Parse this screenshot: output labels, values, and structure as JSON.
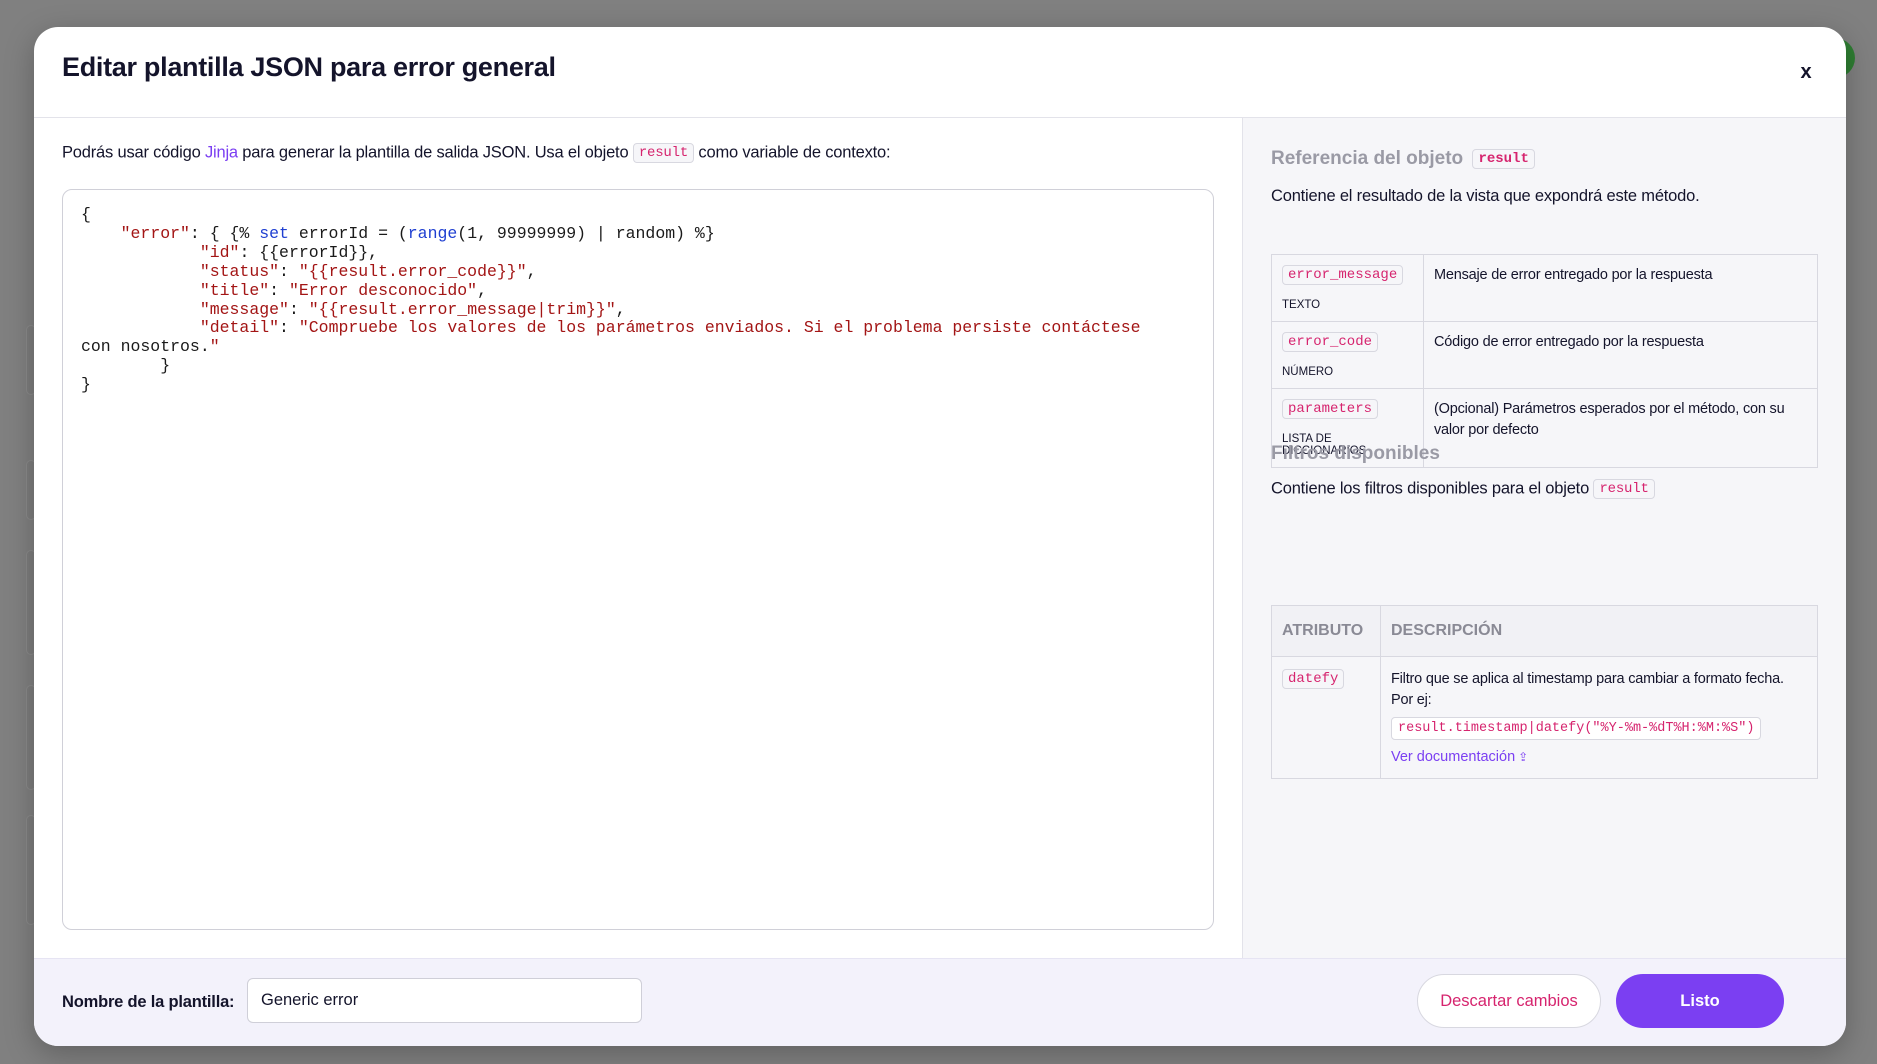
{
  "modal": {
    "title": "Editar plantilla JSON para error general",
    "close_label": "x"
  },
  "editor_intro": {
    "before_link": "Podrás usar código ",
    "link": "Jinja",
    "middle": " para generar la plantilla de salida JSON. Usa el objeto ",
    "chip": "result",
    "after": " como variable de contexto:"
  },
  "code_lines": [
    "{",
    "    \"error\": { {% set errorId = (range(1, 99999999) | random) %}",
    "            \"id\": {{errorId}},",
    "            \"status\": \"{{result.error_code}}\",",
    "            \"title\": \"Error desconocido\",",
    "            \"message\": \"{{result.error_message|trim}}\",",
    "            \"detail\": \"Compruebe los valores de los parámetros enviados. Si el problema persiste contáctese",
    "con nosotros.\"",
    "        }",
    "}"
  ],
  "reference": {
    "title": "Referencia del objeto",
    "title_chip": "result",
    "subtitle": "Contiene el resultado de la vista que expondrá este método.",
    "rows": [
      {
        "name": "error_message",
        "type": "TEXTO",
        "description": "Mensaje de error entregado por la respuesta"
      },
      {
        "name": "error_code",
        "type": "NÚMERO",
        "description": "Código de error entregado por la respuesta"
      },
      {
        "name": "parameters",
        "type": "LISTA DE DICCIONARIOS",
        "description": "(Opcional) Parámetros esperados por el método, con su valor por defecto"
      }
    ]
  },
  "filters": {
    "title": "Filtros disponibles",
    "subtitle": "Contiene los filtros disponibles para el objeto",
    "subtitle_chip": "result",
    "headers": [
      "ATRIBUTO",
      "DESCRIPCIÓN"
    ],
    "rows": [
      {
        "name": "datefy",
        "description": "Filtro que se aplica al timestamp para cambiar a formato fecha. Por ej:",
        "example": "result.timestamp|datefy(\"%Y-%m-%dT%H:%M:%S\")",
        "link": "Ver documentación"
      }
    ]
  },
  "footer": {
    "name_label": "Nombre de la plantilla:",
    "name_value": "Generic error",
    "discard_label": "Descartar cambios",
    "done_label": "Listo"
  },
  "colors": {
    "accent": "#7b3ff2",
    "code_pink": "#d6246e"
  }
}
